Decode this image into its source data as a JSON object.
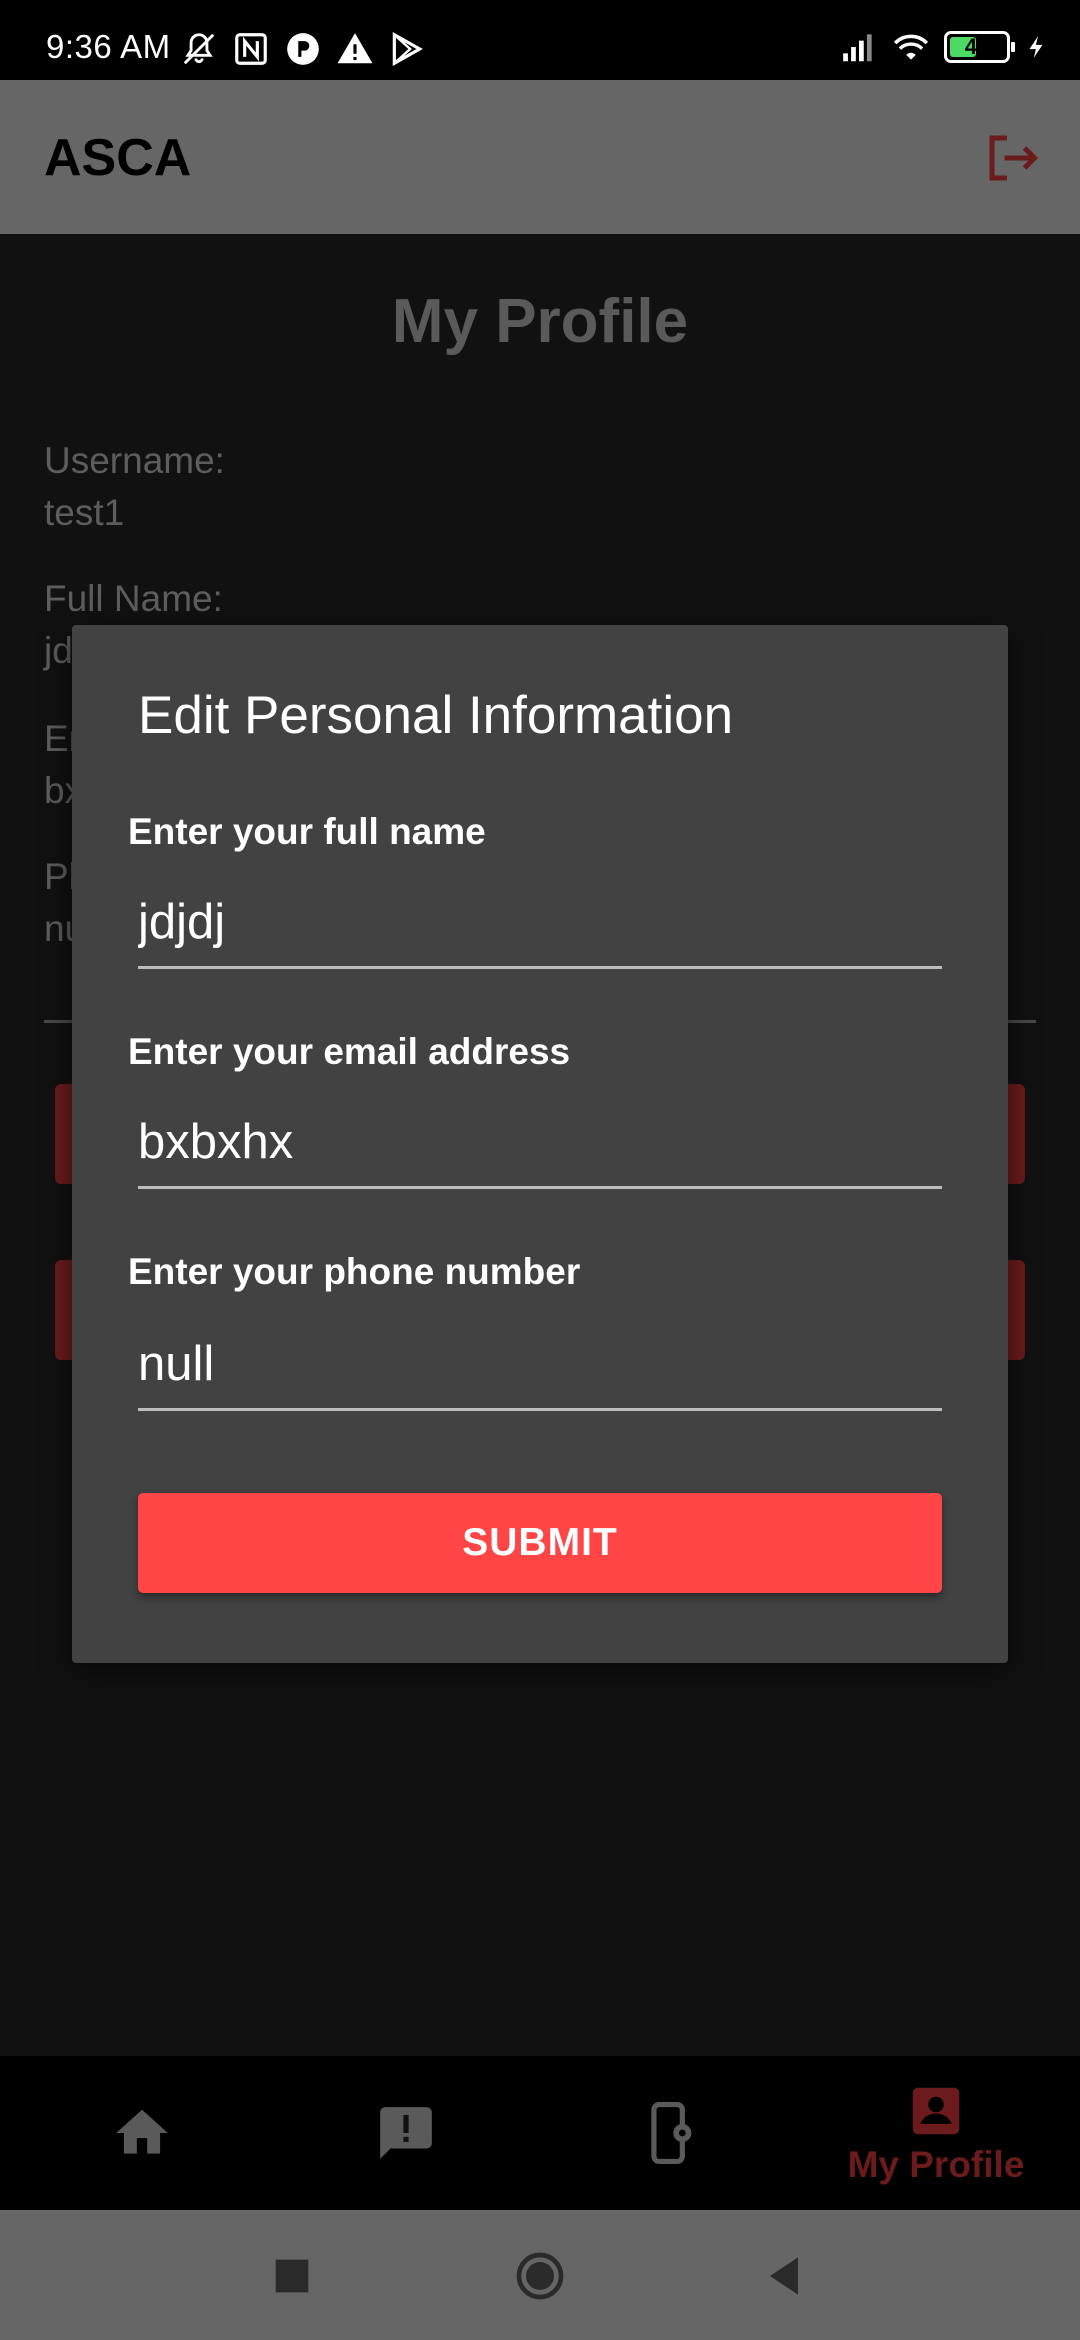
{
  "status_bar": {
    "time": "9:36 AM",
    "battery": "43",
    "icons": [
      "mute-icon",
      "nfc-icon",
      "app-icon",
      "warning-icon",
      "play-store-icon",
      "signal-icon",
      "wifi-icon",
      "battery-icon",
      "charging-icon"
    ]
  },
  "app_bar": {
    "title": "ASCA",
    "logout_icon": "logout-icon",
    "accent": "#6b1b1b"
  },
  "profile": {
    "title": "My Profile",
    "username_label": "Username:",
    "username_value": "test1",
    "fullname_label": "Full Name:",
    "fullname_value": "jd",
    "email_label": "Er",
    "email_value": "bx",
    "phone_label": "Pl",
    "phone_value": "nu"
  },
  "dialog": {
    "title": "Edit Personal Information",
    "fullname_label": "Enter your full name",
    "fullname_value": "jdjdj",
    "email_label": "Enter your email address",
    "email_value": "bxbxhx",
    "phone_label": "Enter your phone number",
    "phone_value": "null",
    "submit_label": "SUBMIT",
    "submit_color": "#ff4545"
  },
  "bottom_nav": {
    "items": [
      {
        "icon": "home-icon",
        "label": ""
      },
      {
        "icon": "report-icon",
        "label": ""
      },
      {
        "icon": "device-settings-icon",
        "label": ""
      },
      {
        "icon": "profile-icon",
        "label": "My Profile",
        "active": true
      }
    ]
  },
  "system_nav": {
    "buttons": [
      "recents-button",
      "home-button",
      "back-button"
    ]
  }
}
